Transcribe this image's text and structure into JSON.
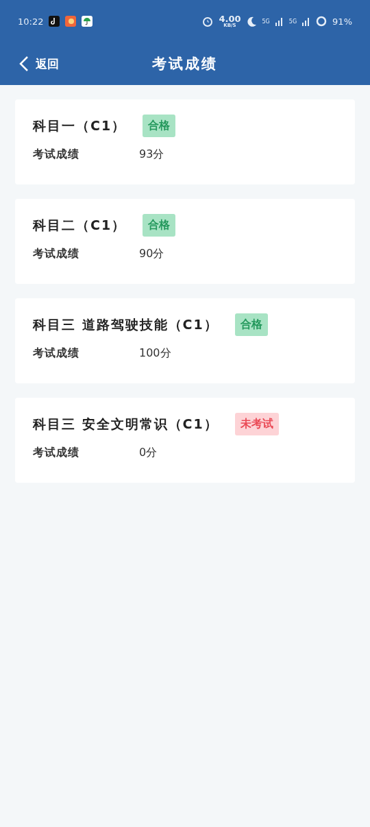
{
  "status_bar": {
    "time": "10:22",
    "speed": "4.00",
    "speed_unit": "KB/S",
    "network_1": "5G",
    "network_2": "5G",
    "battery": "91%"
  },
  "nav": {
    "back": "返回",
    "title": "考试成绩"
  },
  "results": [
    {
      "subject": "科目一（C1）",
      "badge": {
        "kind": "pass",
        "text": "合格"
      },
      "label": "考试成绩",
      "score": "93分"
    },
    {
      "subject": "科目二（C1）",
      "badge": {
        "kind": "pass",
        "text": "合格"
      },
      "label": "考试成绩",
      "score": "90分"
    },
    {
      "subject": "科目三 道路驾驶技能（C1）",
      "badge": {
        "kind": "pass",
        "text": "合格"
      },
      "label": "考试成绩",
      "score": "100分"
    },
    {
      "subject": "科目三 安全文明常识（C1）",
      "badge": {
        "kind": "pending",
        "text": "未考试"
      },
      "label": "考试成绩",
      "score": "0分"
    }
  ]
}
